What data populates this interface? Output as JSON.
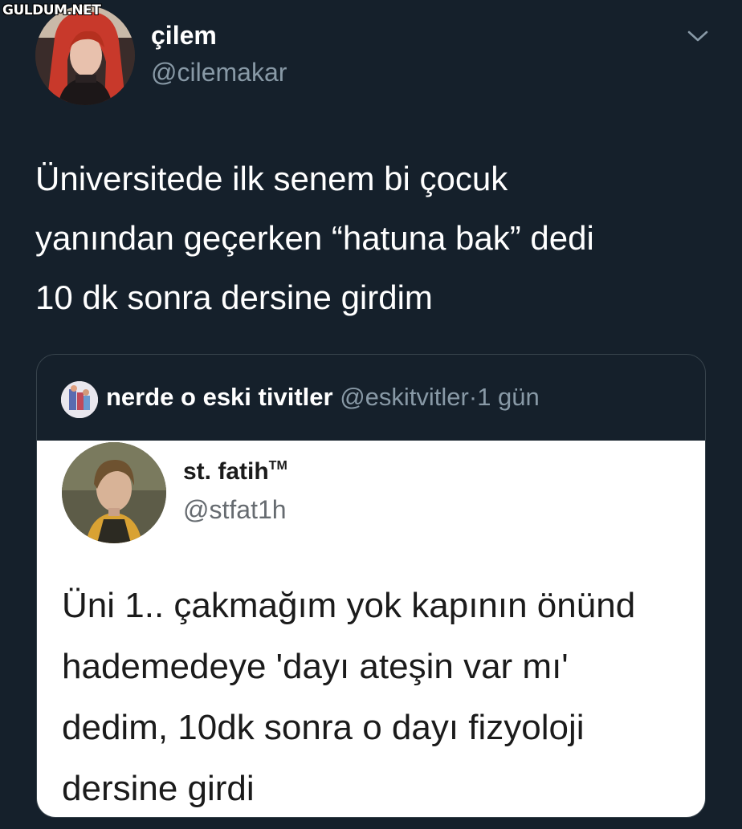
{
  "watermark": "GULDUM.NET",
  "tweet": {
    "author_name": "çilem",
    "author_handle": "@cilemakar",
    "text_lines": [
      "Üniversitede ilk senem bi çocuk",
      "yanından geçerken “hatuna bak” dedi",
      "10 dk sonra dersine girdim"
    ],
    "menu_icon": "chevron-down-icon"
  },
  "quote": {
    "author_name": "nerde o eski tivitler",
    "author_handle": "@eskitvitler",
    "separator": "·",
    "time": "1 gün",
    "embedded": {
      "author_name": "st. fatih",
      "trademark": "TM",
      "author_handle": "@stfat1h",
      "text_lines": [
        "Üni 1.. çakmağım yok kapının önünd",
        "hademedeye 'dayı ateşin var mı'",
        "dedim, 10dk sonra o dayı fizyoloji",
        "dersine girdi"
      ]
    }
  },
  "colors": {
    "background": "#15202b",
    "primary_text": "#ffffff",
    "secondary_text": "#8899a6",
    "card_border": "#38444d"
  }
}
